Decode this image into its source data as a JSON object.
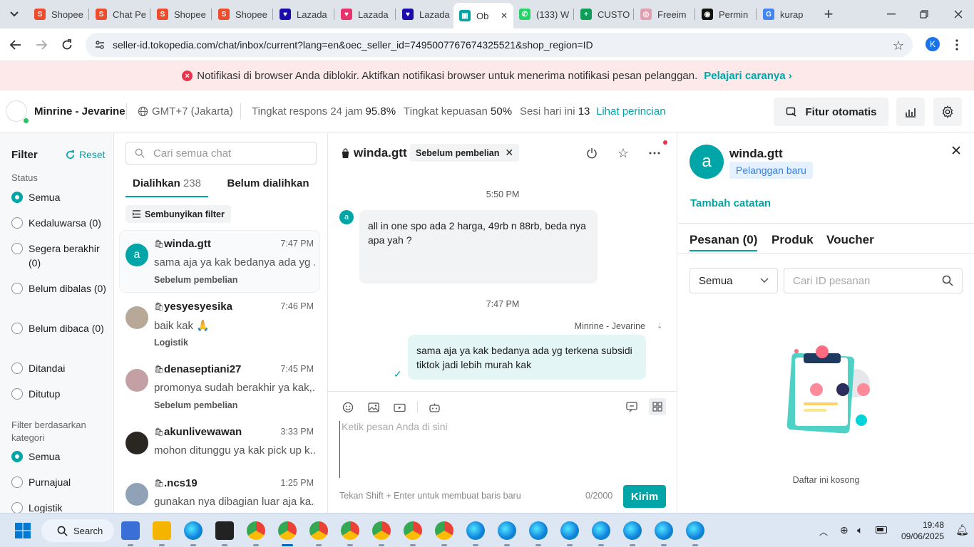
{
  "browser": {
    "tabs": [
      {
        "label": "Shopee",
        "color": "#ee4d2d",
        "glyph": "S"
      },
      {
        "label": "Chat Pe",
        "color": "#ee4d2d",
        "glyph": "S"
      },
      {
        "label": "Shopee",
        "color": "#ee4d2d",
        "glyph": "S"
      },
      {
        "label": "Shopee",
        "color": "#ee4d2d",
        "glyph": "S"
      },
      {
        "label": "Lazada",
        "color": "#1a0dab",
        "glyph": "♥"
      },
      {
        "label": "Lazada",
        "color": "#e8336a",
        "glyph": "♥"
      },
      {
        "label": "Lazada",
        "color": "#1a0dab",
        "glyph": "♥"
      },
      {
        "label": "Ob",
        "color": "#00a5a8",
        "glyph": "▣"
      },
      {
        "label": "(133) W",
        "color": "#25d366",
        "glyph": "✆"
      },
      {
        "label": "CUSTO",
        "color": "#0f9d58",
        "glyph": "+"
      },
      {
        "label": "Freeim",
        "color": "#e0a0b0",
        "glyph": "◎"
      },
      {
        "label": "Permin",
        "color": "#111111",
        "glyph": "◉"
      },
      {
        "label": "kurap",
        "color": "#4285f4",
        "glyph": "G"
      }
    ],
    "url": "seller-id.tokopedia.com/chat/inbox/current?lang=en&oec_seller_id=7495007767674325521&shop_region=ID",
    "profile_initial": "K"
  },
  "notice": {
    "text": "Notifikasi di browser Anda diblokir. Aktifkan notifikasi browser untuk menerima notifikasi pesan pelanggan.",
    "link": "Pelajari caranya"
  },
  "seller": {
    "shop_name": "Minrine - Jevarine",
    "timezone": "GMT+7 (Jakarta)",
    "response_label": "Tingkat respons 24 jam",
    "response_value": "95.8%",
    "satisfaction_label": "Tingkat kepuasan",
    "satisfaction_value": "50%",
    "sessions_label": "Sesi hari ini",
    "sessions_value": "13",
    "details_link": "Lihat perincian",
    "auto_button": "Fitur otomatis"
  },
  "filter": {
    "title": "Filter",
    "reset": "Reset",
    "status_title": "Status",
    "status_items": [
      {
        "label": "Semua",
        "checked": true
      },
      {
        "label": "Kedaluwarsa (0)",
        "checked": false
      },
      {
        "label": "Segera berakhir (0)",
        "checked": false
      },
      {
        "label": "Belum dibalas (0)",
        "checked": false
      },
      {
        "label": "Belum dibaca (0)",
        "checked": false
      },
      {
        "label": "Ditandai",
        "checked": false
      },
      {
        "label": "Ditutup",
        "checked": false
      }
    ],
    "category_title": "Filter berdasarkan kategori",
    "category_items": [
      {
        "label": "Semua",
        "checked": true
      },
      {
        "label": "Purnajual",
        "checked": false
      },
      {
        "label": "Logistik",
        "checked": false
      }
    ]
  },
  "chatlist": {
    "search_placeholder": "Cari semua chat",
    "tab_assigned": "Dialihkan",
    "tab_assigned_count": "238",
    "tab_unassigned": "Belum dialihkan",
    "hide_filter": "Sembunyikan filter",
    "conversations": [
      {
        "name": "winda.gtt",
        "time": "7:47 PM",
        "preview": "sama aja ya kak bedanya ada yg ...",
        "tag": "Sebelum pembelian",
        "avatar": "a",
        "avatar_color": "#00a5a8"
      },
      {
        "name": "yesyesyesika",
        "time": "7:46 PM",
        "preview": "baik kak 🙏",
        "tag": "Logistik",
        "avatar": "",
        "avatar_color": "#b8a898"
      },
      {
        "name": "denaseptiani27",
        "time": "7:45 PM",
        "preview": "promonya sudah berakhir ya kak,...",
        "tag": "Sebelum pembelian",
        "avatar": "",
        "avatar_color": "#c2a0a4"
      },
      {
        "name": "akunlivewawan",
        "time": "3:33 PM",
        "preview": "mohon ditunggu ya kak pick up k...",
        "tag": "",
        "avatar": "",
        "avatar_color": "#2a2622"
      },
      {
        "name": ".ncs19",
        "time": "1:25 PM",
        "preview": "gunakan nya dibagian luar aja ka...",
        "tag": "",
        "avatar": "",
        "avatar_color": "#8fa2b6"
      }
    ]
  },
  "chat": {
    "username": "winda.gtt",
    "tag": "Sebelum pembelian",
    "time1": "5:50 PM",
    "msg1": "all in one spo ada 2 harga, 49rb n 88rb, beda nya apa yah ?",
    "time2": "7:47 PM",
    "sender": "Minrine - Jevarine",
    "msg2": "sama aja ya kak bedanya ada yg terkena subsidi tiktok jadi lebih murah kak",
    "input_placeholder": "Ketik pesan Anda di sini",
    "hint": "Tekan Shift + Enter untuk membuat baris baru",
    "counter": "0/2000",
    "send": "Kirim"
  },
  "customer": {
    "avatar": "a",
    "name": "winda.gtt",
    "badge": "Pelanggan baru",
    "add_note": "Tambah catatan",
    "tabs": [
      "Pesanan (0)",
      "Produk",
      "Voucher"
    ],
    "filter_select": "Semua",
    "order_search_placeholder": "Cari ID pesanan",
    "empty_text": "Daftar ini kosong"
  },
  "taskbar": {
    "search": "Search",
    "time": "19:48",
    "date": "09/06/2025"
  },
  "colors": {
    "accent": "#00a5a8",
    "notice_bg": "#fde9ea",
    "error": "#e8334a",
    "bubble_in": "#f2f3f5",
    "bubble_out": "#e3f6f5"
  }
}
